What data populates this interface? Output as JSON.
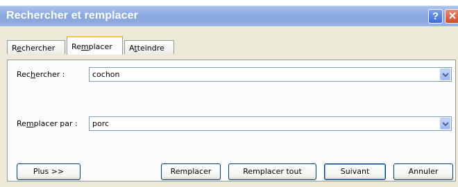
{
  "window": {
    "title": "Rechercher et remplacer",
    "help_glyph": "?",
    "close_glyph": "✕",
    "background_ghost_text": "…"
  },
  "tabs": [
    {
      "label": "Rechercher",
      "underline_index": 1,
      "active": false
    },
    {
      "label": "Remplacer",
      "underline_index": 2,
      "active": true
    },
    {
      "label": "Atteindre",
      "underline_index": 1,
      "active": false
    }
  ],
  "find": {
    "label": "Rechercher :",
    "underline_index": 3,
    "value": "cochon"
  },
  "replace": {
    "label": "Remplacer par :",
    "underline_index": 2,
    "value": "porc"
  },
  "buttons": {
    "more": "Plus >>",
    "replace": "Remplacer",
    "replace_all": "Remplacer tout",
    "next": "Suivant",
    "cancel": "Annuler"
  },
  "colors": {
    "title_bar": "#8ba8df",
    "dialog_bg": "#ece9d8",
    "active_tab_accent": "#ffc83c",
    "button_border": "#003c74"
  },
  "icons": [
    "help-icon",
    "close-icon",
    "dropdown-arrow-icon"
  ]
}
